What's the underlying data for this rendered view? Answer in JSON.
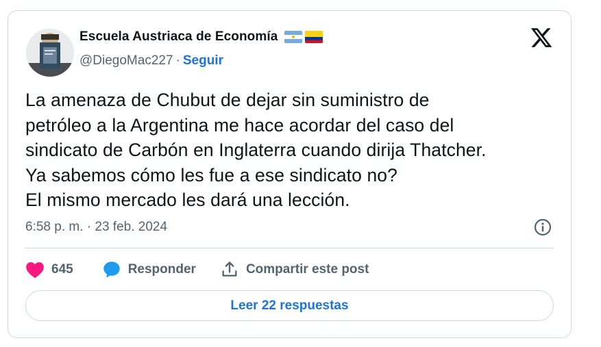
{
  "author": {
    "name": "Escuela Austriaca de Economía",
    "handle": "@DiegoMac227",
    "separator": "·",
    "follow_label": "Seguir",
    "flags": [
      "argentina-flag",
      "colombia-flag"
    ]
  },
  "tweet": {
    "text": "La amenaza de Chubut  de dejar sin suministro de\npetróleo a la Argentina me hace acordar del caso del\nsindicato de Carbón en Inglaterra cuando dirija Thatcher.\nYa sabemos cómo les fue a ese sindicato no?\nEl mismo mercado les dará una lección.",
    "timestamp": "6:58 p. m. · 23 feb. 2024"
  },
  "actions": {
    "likes_count": "645",
    "reply_label": "Responder",
    "share_label": "Compartir este post"
  },
  "read_replies_label": "Leer 22 respuestas",
  "icons": {
    "logo": "x-logo-icon",
    "info": "info-icon",
    "like": "heart-icon",
    "reply": "speech-bubble-icon",
    "share": "share-icon"
  },
  "colors": {
    "link": "#1d74d6",
    "like": "#f91880",
    "reply": "#1d9bf0",
    "secondary_text": "#536471",
    "border": "#cfd9de"
  }
}
